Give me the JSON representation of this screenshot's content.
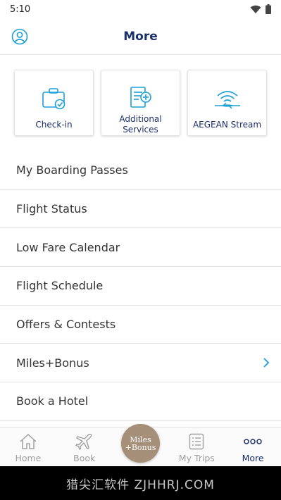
{
  "status": {
    "time": "5:10"
  },
  "header": {
    "title": "More"
  },
  "cards": [
    {
      "label": "Check-in",
      "icon": "suitcase-check-icon"
    },
    {
      "label": "Additional\nServices",
      "icon": "document-plus-icon"
    },
    {
      "label": "AEGEAN Stream",
      "icon": "wifi-plane-icon"
    }
  ],
  "menu": {
    "items": [
      {
        "label": "My Boarding Passes"
      },
      {
        "label": "Flight Status"
      },
      {
        "label": "Low Fare Calendar"
      },
      {
        "label": "Flight Schedule"
      },
      {
        "label": "Offers & Contests"
      },
      {
        "label": "Miles+Bonus",
        "has_chevron": true
      },
      {
        "label": "Book a Hotel"
      }
    ]
  },
  "tabs": [
    {
      "label": "Home",
      "icon": "home-icon"
    },
    {
      "label": "Book",
      "icon": "plane-icon"
    },
    {
      "label": "",
      "icon": "miles-bonus-logo"
    },
    {
      "label": "My Trips",
      "icon": "list-icon"
    },
    {
      "label": "More",
      "icon": "more-dots-icon",
      "active": true
    }
  ],
  "center_button": {
    "line1": "Miles",
    "line2": "+Bonus"
  },
  "colors": {
    "brand_navy": "#1b2f6a",
    "accent_blue": "#1aa0d8",
    "miles_bronze": "#a68f79",
    "inactive_grey": "#a0a0a0"
  },
  "watermark": {
    "text": "猎尖汇软件 ZJHHRJ.COM"
  }
}
